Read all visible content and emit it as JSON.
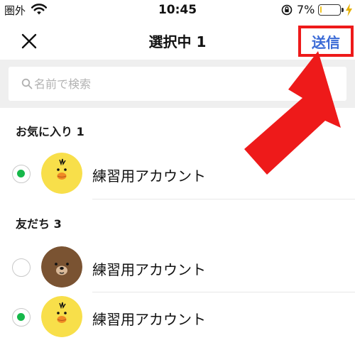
{
  "status_bar": {
    "carrier": "圏外",
    "time": "10:45",
    "battery_percent": "7%",
    "battery_level": 0.07
  },
  "header": {
    "title": "選択中 1",
    "send_label": "送信"
  },
  "search": {
    "placeholder": "名前で検索"
  },
  "sections": {
    "favorites": {
      "header": "お気に入り 1",
      "items": [
        {
          "name": "練習用アカウント",
          "selected": true,
          "avatar": "sally-duck"
        }
      ]
    },
    "friends": {
      "header": "友だち 3",
      "items": [
        {
          "name": "練習用アカウント",
          "selected": false,
          "avatar": "brown-bear"
        },
        {
          "name": "練習用アカウント",
          "selected": true,
          "avatar": "sally-duck"
        }
      ]
    }
  },
  "colors": {
    "accent": "#3a6ad6",
    "selected": "#16b84a",
    "highlight": "#ee1a1a"
  }
}
